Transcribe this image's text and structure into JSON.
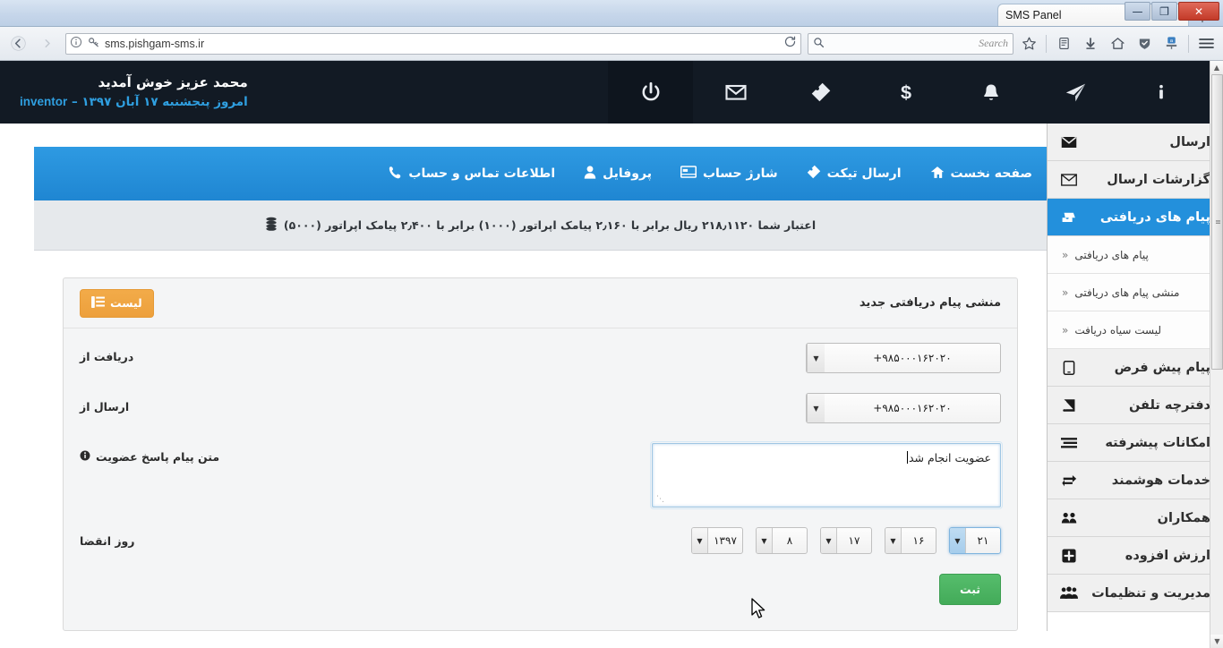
{
  "browser": {
    "tab_title": "SMS Panel",
    "tab_close_glyph": "✕",
    "newtab_glyph": "+",
    "url": "sms.pishgam-sms.ir",
    "search_placeholder": "Search",
    "window_buttons": {
      "minimize": "—",
      "restore": "❐",
      "close": "✕"
    },
    "toolbar_icons": [
      "back-icon",
      "forward-icon",
      "info-icon",
      "key-icon",
      "reload-icon",
      "search-icon",
      "bookmark-star-icon",
      "reader-icon",
      "download-icon",
      "home-icon",
      "shield-icon",
      "addon-icon",
      "menu-icon"
    ]
  },
  "topbar": {
    "icons": [
      "power-icon",
      "envelope-icon",
      "ticket-icon",
      "dollar-icon",
      "bell-icon",
      "send-icon",
      "info-icon"
    ],
    "welcome_line1": "محمد عزیز خوش آمدید",
    "welcome_user": "inventor",
    "welcome_dash": " – ",
    "welcome_date": "امروز پنجشنبه ۱۷ آبان ۱۳۹۷"
  },
  "topnav": {
    "items": [
      {
        "label": "صفحه نخست",
        "icon": "home-icon"
      },
      {
        "label": "ارسال تیکت",
        "icon": "ticket-icon"
      },
      {
        "label": "شارژ حساب",
        "icon": "card-icon"
      },
      {
        "label": "پروفایل",
        "icon": "user-icon"
      },
      {
        "label": "اطلاعات تماس و حساب",
        "icon": "phone-icon"
      }
    ]
  },
  "credit": {
    "icon": "coins-icon",
    "text": "اعتبار شما ۲۱۸٫۱۱۲۰ ریال برابر با ۲٫۱۶۰ پیامک اپراتور (۱۰۰۰) برابر با ۲٫۴۰۰ پیامک اپراتور (۵۰۰۰)"
  },
  "sidebar": {
    "items": [
      {
        "label": "ارسال",
        "icon": "envelope-filled-icon",
        "active": false
      },
      {
        "label": "گزارشات ارسال",
        "icon": "envelope-outline-icon",
        "active": false
      },
      {
        "label": "پیام های دریافتی",
        "icon": "inbox-icon",
        "active": true
      },
      {
        "label": "پیام پیش فرض",
        "icon": "tablet-icon",
        "active": false
      },
      {
        "label": "دفترچه تلفن",
        "icon": "book-icon",
        "active": false
      },
      {
        "label": "امکانات پیشرفته",
        "icon": "lines-icon",
        "active": false
      },
      {
        "label": "خدمات هوشمند",
        "icon": "exchange-icon",
        "active": false
      },
      {
        "label": "همکاران",
        "icon": "users-icon",
        "active": false
      },
      {
        "label": "ارزش افزوده",
        "icon": "plus-square-icon",
        "active": false
      },
      {
        "label": "مدیریت و تنظیمات",
        "icon": "group-icon",
        "active": false
      }
    ],
    "submenu": [
      {
        "label": "پیام های دریافتی",
        "chevron": "«"
      },
      {
        "label": "منشی پیام های دریافتی",
        "chevron": "«"
      },
      {
        "label": "لیست سیاه دریافت",
        "chevron": "«"
      }
    ]
  },
  "panel": {
    "title": "منشی پیام دریافتی جدید",
    "list_button": "لیست",
    "list_button_icon": "list-icon",
    "fields": {
      "receive_from_label": "دریافت از",
      "receive_from_value": "+۹۸۵۰۰۰۱۶۲۰۲۰",
      "send_from_label": "ارسال از",
      "send_from_value": "+۹۸۵۰۰۰۱۶۲۰۲۰",
      "reply_text_label": "متن پیام پاسخ عضویت",
      "reply_text_info_icon": "info-circle-icon",
      "reply_text_value": "عضویت انجام شد",
      "expiry_label": "روز انقضا"
    },
    "expiry_selects": [
      {
        "value": "۲۱",
        "focused": true,
        "name": "expiry-minute-select"
      },
      {
        "value": "۱۶",
        "focused": false,
        "name": "expiry-hour-select"
      },
      {
        "value": "۱۷",
        "focused": false,
        "name": "expiry-day-select"
      },
      {
        "value": "۸",
        "focused": false,
        "name": "expiry-month-select"
      },
      {
        "value": "۱۳۹۷",
        "focused": false,
        "name": "expiry-year-select"
      }
    ],
    "submit_button": "ثبت"
  },
  "colors": {
    "brand_blue": "#2390dc",
    "topbar_dark": "#121a24",
    "accent_orange": "#eda03c",
    "success_green": "#43ab59",
    "link_blue": "#2f9fe0"
  }
}
